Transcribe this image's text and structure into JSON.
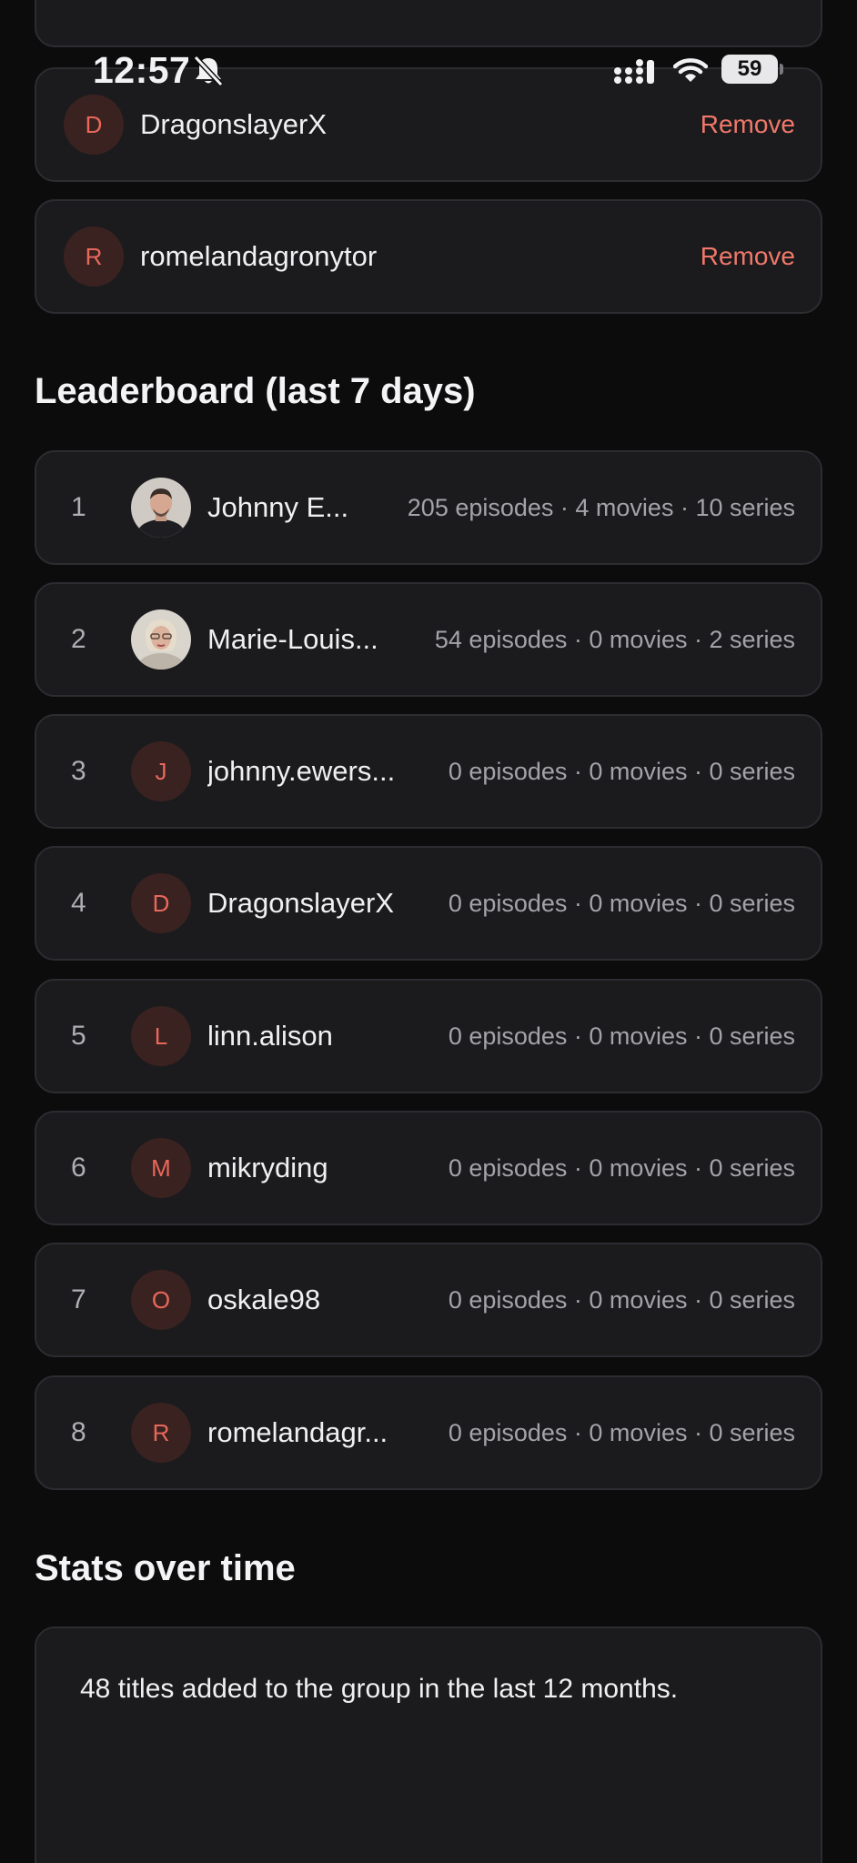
{
  "status_bar": {
    "time": "12:57",
    "battery": "59"
  },
  "members_partial": [
    {
      "initial": "D",
      "name": "DragonslayerX",
      "action": "Remove"
    },
    {
      "initial": "R",
      "name": "romelandagronytor",
      "action": "Remove"
    }
  ],
  "leaderboard": {
    "title": "Leaderboard (last 7 days)",
    "rows": [
      {
        "rank": "1",
        "initial": "",
        "name": "Johnny E...",
        "stats": "205 episodes · 4 movies · 10 series"
      },
      {
        "rank": "2",
        "initial": "",
        "name": "Marie-Louis...",
        "stats": "54 episodes · 0 movies · 2 series"
      },
      {
        "rank": "3",
        "initial": "J",
        "name": "johnny.ewers...",
        "stats": "0 episodes · 0 movies · 0 series"
      },
      {
        "rank": "4",
        "initial": "D",
        "name": "DragonslayerX",
        "stats": "0 episodes · 0 movies · 0 series"
      },
      {
        "rank": "5",
        "initial": "L",
        "name": "linn.alison",
        "stats": "0 episodes · 0 movies · 0 series"
      },
      {
        "rank": "6",
        "initial": "M",
        "name": "mikryding",
        "stats": "0 episodes · 0 movies · 0 series"
      },
      {
        "rank": "7",
        "initial": "O",
        "name": "oskale98",
        "stats": "0 episodes · 0 movies · 0 series"
      },
      {
        "rank": "8",
        "initial": "R",
        "name": "romelandagr...",
        "stats": "0 episodes · 0 movies · 0 series"
      }
    ]
  },
  "stats_over_time": {
    "title": "Stats over time",
    "summary": "48 titles added to the group in the last 12 months."
  },
  "colors": {
    "accent": "#f0786a",
    "card": "#1b1b1e",
    "background": "#0c0c0d"
  }
}
